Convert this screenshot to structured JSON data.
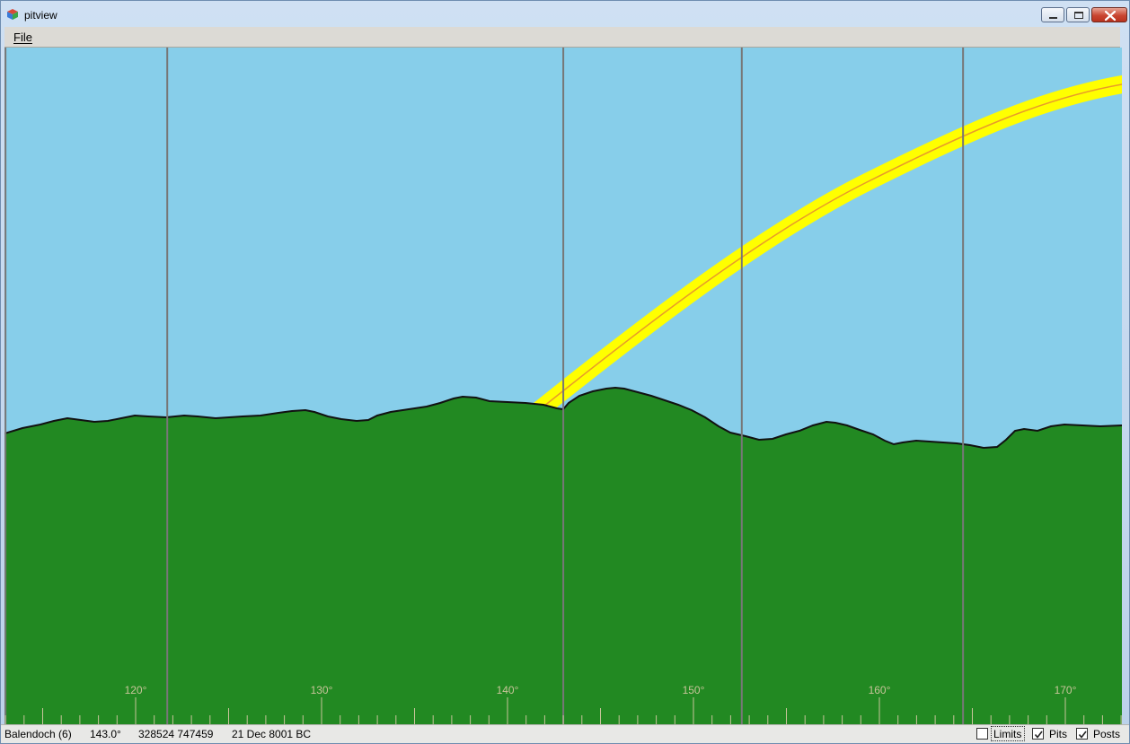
{
  "window": {
    "title": "pitview",
    "minimize_label": "minimize",
    "maximize_label": "maximize",
    "close_label": "close"
  },
  "menu": {
    "file_label": "File"
  },
  "view": {
    "sky_color": "#87ceea",
    "ground_color": "#228922",
    "sun_band_color": "#ffff00",
    "sun_path_color": "#e89a2a",
    "gridline_color": "#777777",
    "axis_label_color": "#c8c49a",
    "azimuth_labels": [
      "120°",
      "130°",
      "140°",
      "150°",
      "160°",
      "170°"
    ],
    "azimuth_values": [
      120,
      130,
      140,
      150,
      160,
      170
    ],
    "vertical_markers_deg": [
      113.0,
      121.7,
      143.0,
      152.6,
      164.5
    ]
  },
  "status": {
    "site": "Balendoch (6)",
    "azimuth": "143.0°",
    "coords": "328524 747459",
    "date": "21 Dec 8001 BC",
    "limits_label": "Limits",
    "limits_checked": false,
    "pits_label": "Pits",
    "pits_checked": true,
    "posts_label": "Posts",
    "posts_checked": true
  }
}
